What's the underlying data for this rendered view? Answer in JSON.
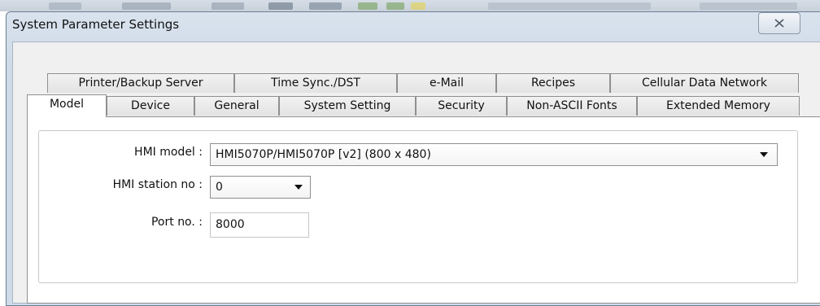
{
  "window": {
    "title": "System Parameter Settings"
  },
  "tabs": {
    "row_back": [
      {
        "label": "Printer/Backup Server"
      },
      {
        "label": "Time Sync./DST"
      },
      {
        "label": "e-Mail"
      },
      {
        "label": "Recipes"
      },
      {
        "label": "Cellular Data Network"
      }
    ],
    "row_front": [
      {
        "label": "Model",
        "selected": true
      },
      {
        "label": "Device"
      },
      {
        "label": "General"
      },
      {
        "label": "System Setting"
      },
      {
        "label": "Security"
      },
      {
        "label": "Non-ASCII Fonts"
      },
      {
        "label": "Extended Memory"
      }
    ]
  },
  "model_tab": {
    "hmi_model": {
      "label": "HMI model :",
      "value": "HMI5070P/HMI5070P [v2] (800 x 480)"
    },
    "hmi_station_no": {
      "label": "HMI station no :",
      "value": "0"
    },
    "port_no": {
      "label": "Port no. :",
      "value": "8000"
    }
  },
  "icons": {
    "close": "close-icon",
    "dropdown": "chevron-down-icon"
  },
  "colors": {
    "window_frame": "#cfdbe8",
    "panel": "#ffffff",
    "tab_border": "#8e8f8f"
  }
}
